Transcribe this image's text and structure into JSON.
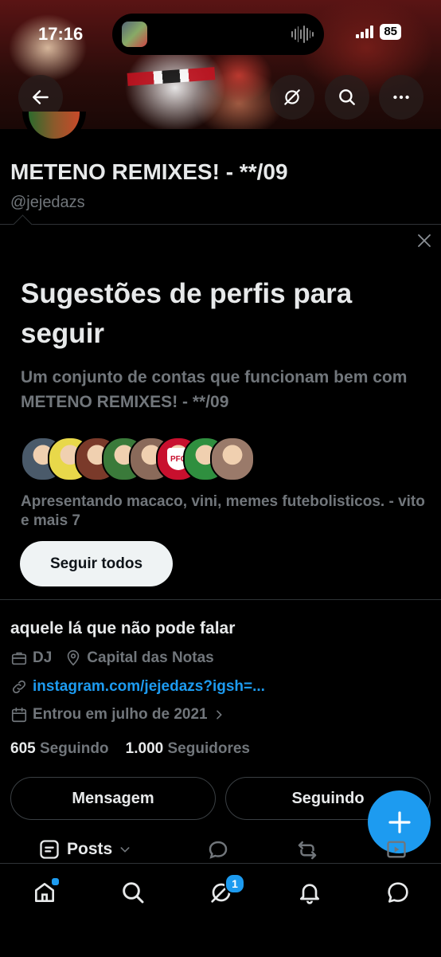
{
  "status_bar": {
    "time": "17:16",
    "battery": "85"
  },
  "profile": {
    "name": "METENO REMIXES! - **/09",
    "handle": "@jejedazs",
    "bio": "aquele lá que não pode falar",
    "job": "DJ",
    "location": "Capital das Notas",
    "link": "instagram.com/jejedazs?igsh=...",
    "joined": "Entrou em julho de 2021",
    "following_count": "605",
    "following_label": "Seguindo",
    "followers_count": "1.000",
    "followers_label": "Seguidores"
  },
  "suggestions": {
    "title": "Sugestões de perfis para seguir",
    "subtitle": "Um conjunto de contas que funcionam bem com METENO REMIXES! - **/09",
    "description": "Apresentando macaco, vini, memes futebolisticos. - vito e mais 7",
    "follow_all": "Seguir todos",
    "avatar_colors": [
      "#4a5a6a",
      "#e8d84a",
      "#7a3a2a",
      "#3a7a3a",
      "#8a6a5a",
      "#c8102e",
      "#2f8f3f",
      "#9a7a6a"
    ],
    "pfc_text": "PFC"
  },
  "actions": {
    "message": "Mensagem",
    "following": "Seguindo"
  },
  "tabs": {
    "posts": "Posts"
  },
  "nav": {
    "messages_badge": "1"
  },
  "colors": {
    "accent": "#1d9bf0",
    "background": "#000000",
    "muted": "#71767b"
  }
}
